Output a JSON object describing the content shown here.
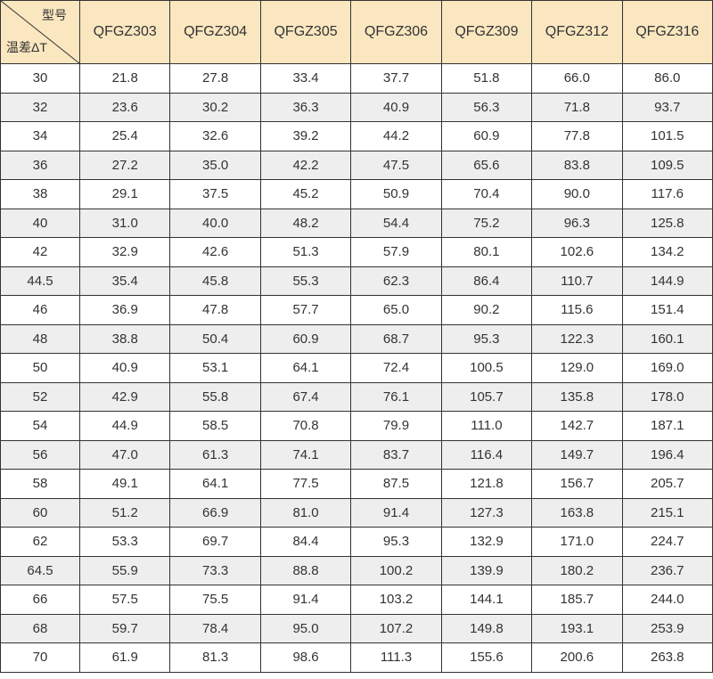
{
  "table": {
    "corner_top": "型号",
    "corner_bottom": "温差ΔT",
    "columns": [
      "QFGZ303",
      "QFGZ304",
      "QFGZ305",
      "QFGZ306",
      "QFGZ309",
      "QFGZ312",
      "QFGZ316"
    ],
    "rows": [
      {
        "dt": "30",
        "values": [
          "21.8",
          "27.8",
          "33.4",
          "37.7",
          "51.8",
          "66.0",
          "86.0"
        ]
      },
      {
        "dt": "32",
        "values": [
          "23.6",
          "30.2",
          "36.3",
          "40.9",
          "56.3",
          "71.8",
          "93.7"
        ]
      },
      {
        "dt": "34",
        "values": [
          "25.4",
          "32.6",
          "39.2",
          "44.2",
          "60.9",
          "77.8",
          "101.5"
        ]
      },
      {
        "dt": "36",
        "values": [
          "27.2",
          "35.0",
          "42.2",
          "47.5",
          "65.6",
          "83.8",
          "109.5"
        ]
      },
      {
        "dt": "38",
        "values": [
          "29.1",
          "37.5",
          "45.2",
          "50.9",
          "70.4",
          "90.0",
          "117.6"
        ]
      },
      {
        "dt": "40",
        "values": [
          "31.0",
          "40.0",
          "48.2",
          "54.4",
          "75.2",
          "96.3",
          "125.8"
        ]
      },
      {
        "dt": "42",
        "values": [
          "32.9",
          "42.6",
          "51.3",
          "57.9",
          "80.1",
          "102.6",
          "134.2"
        ]
      },
      {
        "dt": "44.5",
        "values": [
          "35.4",
          "45.8",
          "55.3",
          "62.3",
          "86.4",
          "110.7",
          "144.9"
        ]
      },
      {
        "dt": "46",
        "values": [
          "36.9",
          "47.8",
          "57.7",
          "65.0",
          "90.2",
          "115.6",
          "151.4"
        ]
      },
      {
        "dt": "48",
        "values": [
          "38.8",
          "50.4",
          "60.9",
          "68.7",
          "95.3",
          "122.3",
          "160.1"
        ]
      },
      {
        "dt": "50",
        "values": [
          "40.9",
          "53.1",
          "64.1",
          "72.4",
          "100.5",
          "129.0",
          "169.0"
        ]
      },
      {
        "dt": "52",
        "values": [
          "42.9",
          "55.8",
          "67.4",
          "76.1",
          "105.7",
          "135.8",
          "178.0"
        ]
      },
      {
        "dt": "54",
        "values": [
          "44.9",
          "58.5",
          "70.8",
          "79.9",
          "111.0",
          "142.7",
          "187.1"
        ]
      },
      {
        "dt": "56",
        "values": [
          "47.0",
          "61.3",
          "74.1",
          "83.7",
          "116.4",
          "149.7",
          "196.4"
        ]
      },
      {
        "dt": "58",
        "values": [
          "49.1",
          "64.1",
          "77.5",
          "87.5",
          "121.8",
          "156.7",
          "205.7"
        ]
      },
      {
        "dt": "60",
        "values": [
          "51.2",
          "66.9",
          "81.0",
          "91.4",
          "127.3",
          "163.8",
          "215.1"
        ]
      },
      {
        "dt": "62",
        "values": [
          "53.3",
          "69.7",
          "84.4",
          "95.3",
          "132.9",
          "171.0",
          "224.7"
        ]
      },
      {
        "dt": "64.5",
        "values": [
          "55.9",
          "73.3",
          "88.8",
          "100.2",
          "139.9",
          "180.2",
          "236.7"
        ]
      },
      {
        "dt": "66",
        "values": [
          "57.5",
          "75.5",
          "91.4",
          "103.2",
          "144.1",
          "185.7",
          "244.0"
        ]
      },
      {
        "dt": "68",
        "values": [
          "59.7",
          "78.4",
          "95.0",
          "107.2",
          "149.8",
          "193.1",
          "253.9"
        ]
      },
      {
        "dt": "70",
        "values": [
          "61.9",
          "81.3",
          "98.6",
          "111.3",
          "155.6",
          "200.6",
          "263.8"
        ]
      }
    ]
  },
  "colors": {
    "header_bg": "#fae7c0",
    "alt_row_bg": "#eeeeee",
    "border": "#333333",
    "text": "#333333"
  }
}
